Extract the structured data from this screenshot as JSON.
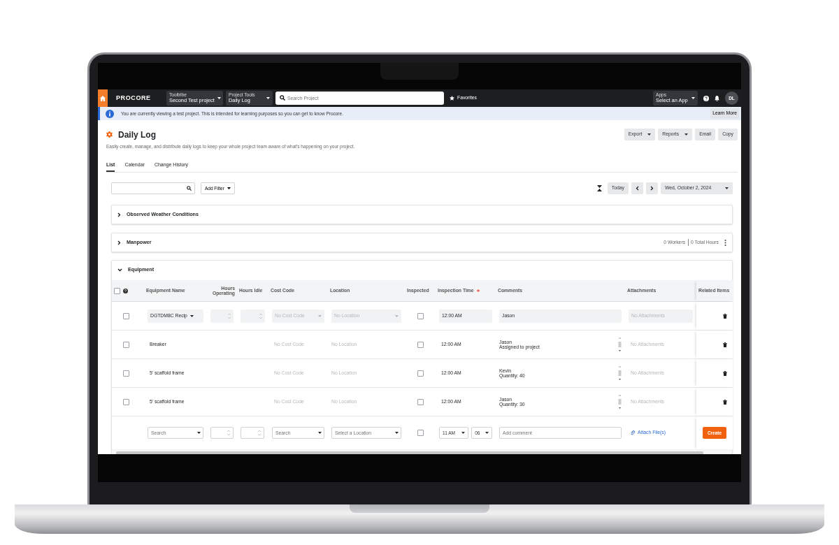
{
  "topbar": {
    "logo": "PROCORE",
    "project": {
      "label": "Tooltribe",
      "value": "Second Test project"
    },
    "tool": {
      "label": "Project Tools",
      "value": "Daily Log"
    },
    "search": {
      "placeholder": "Search Project"
    },
    "favorites": "Favorites",
    "apps": {
      "label": "Apps",
      "value": "Select an App"
    },
    "avatar": "DL"
  },
  "banner": {
    "text": "You are currently viewing a test project. This is intended for learning purposes so you can get to know Procore.",
    "button": "Learn More"
  },
  "header": {
    "title": "Daily Log",
    "description": "Easily create, manage, and distribute daily logs to keep your whole project team aware of what's happening on your project.",
    "actions": [
      {
        "label": "Export",
        "dropdown": true
      },
      {
        "label": "Reports",
        "dropdown": true
      },
      {
        "label": "Email",
        "dropdown": false
      },
      {
        "label": "Copy",
        "dropdown": false
      }
    ]
  },
  "tabs": [
    {
      "label": "List",
      "selected": true
    },
    {
      "label": "Calendar",
      "selected": false
    },
    {
      "label": "Change History",
      "selected": false
    }
  ],
  "toolbar": {
    "add_filter": "Add Filter",
    "today": "Today",
    "date": "Wed, October 2, 2024"
  },
  "sections": [
    {
      "title": "Observed Weather Conditions",
      "expanded": false
    },
    {
      "title": "Manpower",
      "expanded": false,
      "workers": "0 Workers",
      "hours": "0 Total Hours"
    },
    {
      "title": "Equipment",
      "expanded": true
    }
  ],
  "equipment_table": {
    "select_all_checked": false,
    "columns": [
      {
        "label": "Equipment Name",
        "required": false
      },
      {
        "label": "Hours Operating",
        "required": false
      },
      {
        "label": "Hours Idle",
        "required": false
      },
      {
        "label": "Cost Code",
        "required": false
      },
      {
        "label": "Location",
        "required": false
      },
      {
        "label": "Inspected",
        "required": false
      },
      {
        "label": "Inspection Time",
        "required": true
      },
      {
        "label": "Comments",
        "required": false
      },
      {
        "label": "Attachments",
        "required": false
      },
      {
        "label": "Related Items",
        "required": false
      }
    ],
    "rows": [
      {
        "kind": "edit",
        "selected": false,
        "name": "DGTDM8C Recip",
        "cost_code": "No Cost Code",
        "location": "No Location",
        "inspected": false,
        "time": "12:00 AM",
        "comment": "Jason",
        "attachments": "No Attachments"
      },
      {
        "kind": "view",
        "selected": false,
        "name": "Breaker",
        "cost_code": "No Cost Code",
        "location": "No Location",
        "inspected": false,
        "time": "12:00 AM",
        "comment": "Jason\nAssigned to project",
        "attachments": "No Attachments"
      },
      {
        "kind": "view",
        "selected": false,
        "name": "5' scaffold frame",
        "cost_code": "No Cost Code",
        "location": "No Location",
        "inspected": false,
        "time": "12:00 AM",
        "comment": "Kevin\nQuantity: 40",
        "attachments": "No Attachments"
      },
      {
        "kind": "view",
        "selected": false,
        "name": "5' scaffold frame",
        "cost_code": "No Cost Code",
        "location": "No Location",
        "inspected": false,
        "time": "12:00 AM",
        "comment": "Jason\nQuantity: 30",
        "attachments": "No Attachments"
      }
    ],
    "new_row": {
      "equipment": {
        "placeholder": "Search"
      },
      "cost_code": {
        "placeholder": "Search"
      },
      "location": {
        "placeholder": "Select a Location"
      },
      "inspected": false,
      "hour": "11 AM",
      "minute": "06",
      "comment": {
        "placeholder": "Add comment"
      },
      "attach": "Attach File(s)",
      "create": "Create"
    }
  }
}
